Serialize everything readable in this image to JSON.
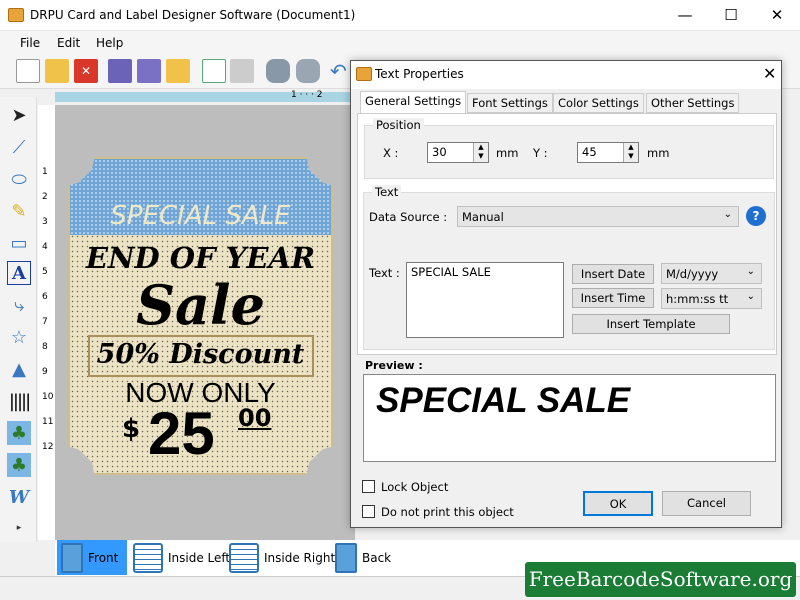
{
  "window": {
    "title": "DRPU Card and Label Designer Software (Document1)",
    "minimize": "—",
    "maximize": "☐",
    "close": "✕"
  },
  "menu": [
    "File",
    "Edit",
    "Help"
  ],
  "toolbar": {
    "icons": [
      "new-document-icon",
      "open-folder-icon",
      "close-red-icon",
      "save-icon",
      "save-as-icon",
      "export-folder-icon",
      "edit-notes-icon",
      "print-icon",
      "database-add-icon",
      "database-icon",
      "undo-icon"
    ]
  },
  "tools": [
    "select-move-icon",
    "line-icon",
    "ellipse-icon",
    "pencil-icon",
    "rectangle-icon",
    "text-icon",
    "bezier-curve-icon",
    "star-icon",
    "triangle-icon",
    "barcode-icon",
    "picture-icon",
    "image-library-icon",
    "word-art-icon"
  ],
  "ruler": {
    "vertical": [
      "1",
      "2",
      "3",
      "4",
      "5",
      "6",
      "7",
      "8",
      "9",
      "10",
      "11",
      "12"
    ],
    "horizontal": "1 · · · 2"
  },
  "card": {
    "header": "SPECIAL SALE",
    "line1": "END OF YEAR",
    "line2": "Sale",
    "discount": "50% Discount",
    "line3": "NOW ONLY",
    "currency": "$",
    "price": "25",
    "cents": "00"
  },
  "pages": [
    {
      "label": "Front",
      "active": true
    },
    {
      "label": "Inside Left"
    },
    {
      "label": "Inside Right"
    },
    {
      "label": "Back"
    }
  ],
  "watermark": "FreeBarcodeSoftware.org",
  "dialog": {
    "title": "Text Properties",
    "close": "✕",
    "tabs": [
      "General Settings",
      "Font Settings",
      "Color Settings",
      "Other Settings"
    ],
    "position": {
      "legend": "Position",
      "x_label": "X :",
      "x_value": "30",
      "x_unit": "mm",
      "y_label": "Y :",
      "y_value": "45",
      "y_unit": "mm"
    },
    "text": {
      "legend": "Text",
      "data_source_label": "Data Source :",
      "data_source_value": "Manual",
      "text_label": "Text :",
      "text_value": "SPECIAL SALE",
      "insert_date": "Insert Date",
      "date_format": "M/d/yyyy",
      "insert_time": "Insert Time",
      "time_format": "h:mm:ss tt",
      "insert_template": "Insert Template"
    },
    "preview_label": "Preview :",
    "preview_text": "SPECIAL SALE",
    "lock_object": "Lock Object",
    "do_not_print": "Do not print this object",
    "ok": "OK",
    "cancel": "Cancel"
  },
  "colors": {
    "accent": "#3399ff",
    "card_blue": "#6fa6d6",
    "card_cream": "#ece3c4",
    "watermark_green": "#1b7c36"
  }
}
